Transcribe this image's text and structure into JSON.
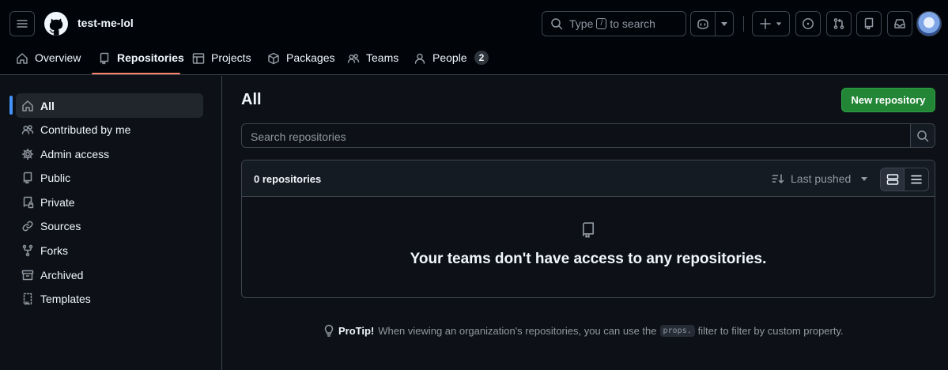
{
  "header": {
    "org_name": "test-me-lol",
    "search": {
      "prefix": "Type",
      "key": "/",
      "suffix": "to search"
    }
  },
  "nav": {
    "overview": "Overview",
    "repositories": "Repositories",
    "projects": "Projects",
    "packages": "Packages",
    "teams": "Teams",
    "people": "People",
    "people_count": "2"
  },
  "sidebar": {
    "items": [
      {
        "label": "All",
        "icon": "home-icon",
        "active": true
      },
      {
        "label": "Contributed by me",
        "icon": "people-icon"
      },
      {
        "label": "Admin access",
        "icon": "gear-icon"
      },
      {
        "label": "Public",
        "icon": "repo-icon"
      },
      {
        "label": "Private",
        "icon": "lock-repo-icon"
      },
      {
        "label": "Sources",
        "icon": "link-icon"
      },
      {
        "label": "Forks",
        "icon": "fork-icon"
      },
      {
        "label": "Archived",
        "icon": "archive-icon"
      },
      {
        "label": "Templates",
        "icon": "template-icon"
      }
    ]
  },
  "main": {
    "title": "All",
    "new_repo_label": "New repository",
    "search_placeholder": "Search repositories",
    "repo_count": "0 repositories",
    "sort_label": "Last pushed",
    "empty_message": "Your teams don't have access to any repositories."
  },
  "protip": {
    "label": "ProTip!",
    "text_before": "When viewing an organization's repositories, you can use the",
    "code": "props.",
    "text_after": "filter to filter by custom property."
  },
  "colors": {
    "background": "#0d1117",
    "header_bg": "#010409",
    "accent_blue": "#4493f8",
    "nav_underline": "#f78166",
    "primary_green": "#238636"
  }
}
